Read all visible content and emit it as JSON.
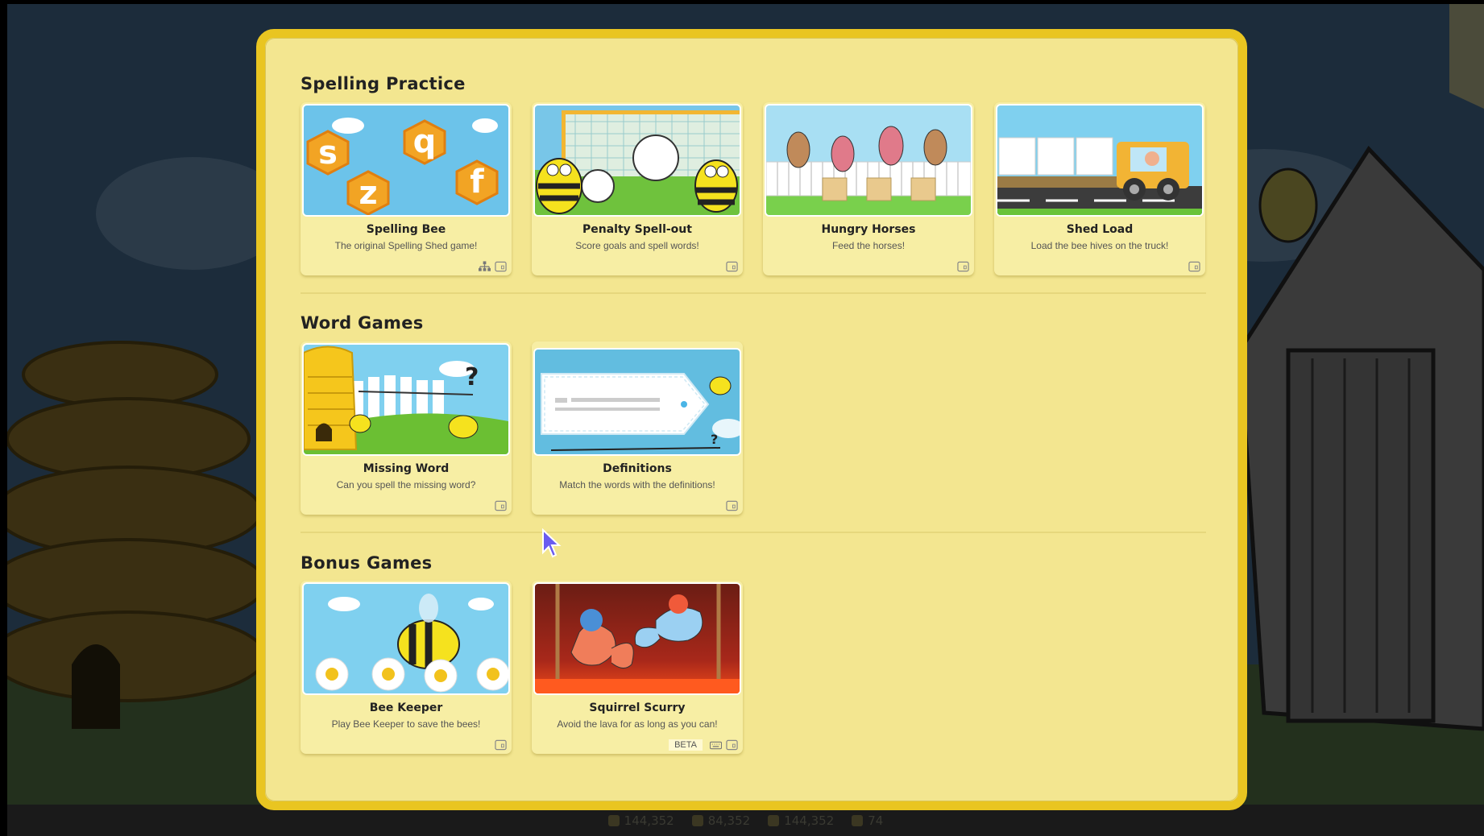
{
  "sections": [
    {
      "title": "Spelling Practice",
      "games": [
        {
          "title": "Spelling Bee",
          "description": "The original Spelling Shed game!",
          "icons": [
            "hierarchy-icon",
            "tablet-icon"
          ]
        },
        {
          "title": "Penalty Spell-out",
          "description": "Score goals and spell words!",
          "icons": [
            "tablet-icon"
          ]
        },
        {
          "title": "Hungry Horses",
          "description": "Feed the horses!",
          "icons": [
            "tablet-icon"
          ]
        },
        {
          "title": "Shed Load",
          "description": "Load the bee hives on the truck!",
          "icons": [
            "tablet-icon"
          ]
        }
      ]
    },
    {
      "title": "Word Games",
      "games": [
        {
          "title": "Missing Word",
          "description": "Can you spell the missing word?",
          "icons": [
            "tablet-icon"
          ]
        },
        {
          "title": "Definitions",
          "description": "Match the words with the definitions!",
          "icons": [
            "tablet-icon"
          ]
        }
      ]
    },
    {
      "title": "Bonus Games",
      "games": [
        {
          "title": "Bee Keeper",
          "description": "Play Bee Keeper to save the bees!",
          "icons": [
            "tablet-icon"
          ]
        },
        {
          "title": "Squirrel Scurry",
          "description": "Avoid the lava for as long as you can!",
          "badge": "BETA",
          "icons": [
            "keyboard-icon",
            "tablet-icon"
          ]
        }
      ]
    }
  ],
  "thumb_letters": [
    "s",
    "q",
    "z",
    "f"
  ],
  "stats": [
    "144,352",
    "84,352",
    "144,352",
    "74"
  ],
  "colors": {
    "modal_bg": "#f3e690",
    "modal_border": "#e9c521",
    "card_bg": "#f7eea4",
    "sky": "#6cc3ea"
  }
}
